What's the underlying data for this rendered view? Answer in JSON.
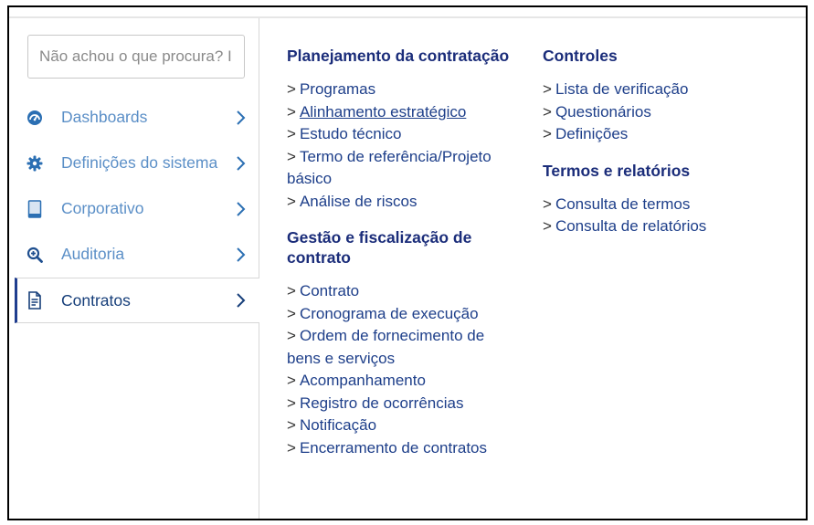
{
  "search": {
    "placeholder": "Não achou o que procura? I"
  },
  "sidebar": {
    "items": [
      {
        "label": "Dashboards"
      },
      {
        "label": "Definições do sistema"
      },
      {
        "label": "Corporativo"
      },
      {
        "label": "Auditoria"
      },
      {
        "label": "Contratos"
      }
    ],
    "active_index": 4
  },
  "columns": {
    "col1": {
      "sections": [
        {
          "title": "Planejamento da contratação",
          "links": [
            "Programas",
            "Alinhamento estratégico",
            "Estudo técnico",
            "Termo de referência/Projeto básico",
            "Análise de riscos"
          ]
        },
        {
          "title": "Gestão e fiscalização de contrato",
          "links": [
            "Contrato",
            "Cronograma de execução",
            "Ordem de fornecimento de bens e serviços",
            "Acompanhamento",
            "Registro de ocorrências",
            "Notificação",
            "Encerramento de contratos"
          ]
        }
      ]
    },
    "col2": {
      "sections": [
        {
          "title": "Controles",
          "links": [
            "Lista de verificação",
            "Questionários",
            "Definições"
          ]
        },
        {
          "title": "Termos e relatórios",
          "links": [
            "Consulta de termos",
            "Consulta de relatórios"
          ]
        }
      ]
    }
  },
  "colors": {
    "link": "#1e3f8a",
    "heading": "#1b2d7a",
    "sidebar_text": "#5b8fc7",
    "active_bar": "#1f3d8f"
  }
}
